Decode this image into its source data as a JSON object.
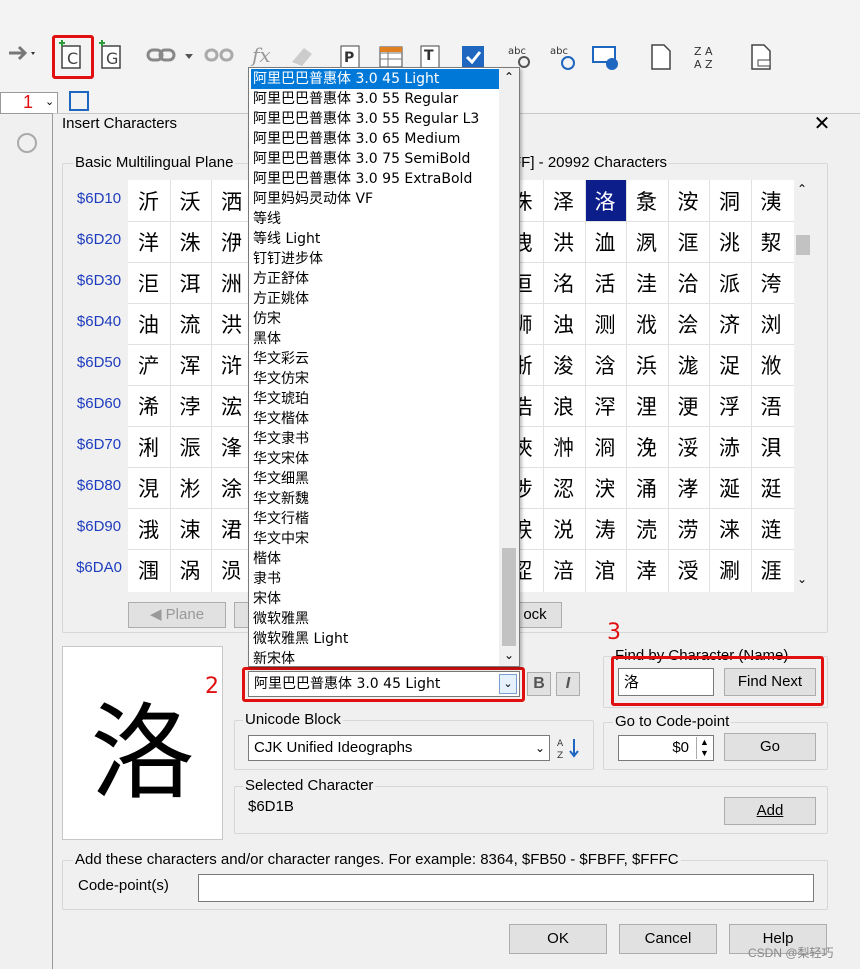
{
  "toolbar": {
    "row2_number_combo": "1",
    "callout_1": "1",
    "callout_2": "2",
    "callout_3": "3"
  },
  "dialog": {
    "title": "Insert Characters",
    "close_symbol": "✕",
    "plane_group_label": "Basic Multilingual Plane",
    "range_label_right": "FF] - 20992 Characters",
    "row_codes": [
      "$6D10",
      "$6D20",
      "$6D30",
      "$6D40",
      "$6D50",
      "$6D60",
      "$6D70",
      "$6D80",
      "$6D90",
      "$6DA0"
    ],
    "grid_left": [
      [
        "沂",
        "沃",
        "洒"
      ],
      [
        "洋",
        "洙",
        "洢"
      ],
      [
        "洰",
        "洱",
        "洲"
      ],
      [
        "油",
        "流",
        "洪"
      ],
      [
        "浐",
        "浑",
        "浒"
      ],
      [
        "浠",
        "浡",
        "浤"
      ],
      [
        "浰",
        "浱",
        "浲"
      ],
      [
        "涀",
        "涁",
        "涂"
      ],
      [
        "涐",
        "涑",
        "涒"
      ],
      [
        "涠",
        "涡",
        "涢"
      ]
    ],
    "grid_right": [
      [
        "洙",
        "泽",
        "洛",
        "洜",
        "洝",
        "洞",
        "洟"
      ],
      [
        "洩",
        "洪",
        "洫",
        "洬",
        "洭",
        "洮",
        "洯"
      ],
      [
        "洹",
        "洺",
        "活",
        "洼",
        "洽",
        "派",
        "洿"
      ],
      [
        "浉",
        "浊",
        "测",
        "浌",
        "浍",
        "济",
        "浏"
      ],
      [
        "浙",
        "浚",
        "浛",
        "浜",
        "浝",
        "浞",
        "浟"
      ],
      [
        "浩",
        "浪",
        "浫",
        "浬",
        "浭",
        "浮",
        "浯"
      ],
      [
        "浹",
        "浺",
        "浻",
        "浼",
        "浽",
        "浾",
        "浿"
      ],
      [
        "涉",
        "涊",
        "涋",
        "涌",
        "涍",
        "涎",
        "涏"
      ],
      [
        "涙",
        "涚",
        "涛",
        "涜",
        "涝",
        "涞",
        "涟"
      ],
      [
        "涩",
        "涪",
        "涫",
        "涬",
        "涭",
        "涮",
        "涯"
      ]
    ],
    "plane_button": "Plane",
    "block_button_fragment": "ock",
    "font_select_value": "阿里巴巴普惠体 3.0 45 Light",
    "bold_label": "B",
    "italic_label": "I",
    "unicode_block_label": "Unicode Block",
    "unicode_block_value": "CJK Unified Ideographs",
    "find_group_label": "Find by Character (Name)",
    "find_input_value": "洛",
    "find_next_button": "Find Next",
    "goto_group_label": "Go to Code-point",
    "goto_value": "$0",
    "go_button": "Go",
    "selected_label": "Selected Character",
    "selected_code": "$6D1B",
    "add_button": "Add",
    "add_ranges_label": "Add these characters and/or character ranges. For example: 8364, $FB50 - $FBFF, $FFFC",
    "codepoints_label": "Code-point(s)",
    "codepoints_value": "",
    "ok_button": "OK",
    "cancel_button": "Cancel",
    "help_button": "Help",
    "preview_char": "洛"
  },
  "font_list": [
    "阿里巴巴普惠体 3.0 45 Light",
    "阿里巴巴普惠体 3.0 55 Regular",
    "阿里巴巴普惠体 3.0 55 Regular L3",
    "阿里巴巴普惠体 3.0 65 Medium",
    "阿里巴巴普惠体 3.0 75 SemiBold",
    "阿里巴巴普惠体 3.0 95 ExtraBold",
    "阿里妈妈灵动体 VF",
    "等线",
    "等线 Light",
    "钉钉进步体",
    "方正舒体",
    "方正姚体",
    "仿宋",
    "黑体",
    "华文彩云",
    "华文仿宋",
    "华文琥珀",
    "华文楷体",
    "华文隶书",
    "华文宋体",
    "华文细黑",
    "华文新魏",
    "华文行楷",
    "华文中宋",
    "楷体",
    "隶书",
    "宋体",
    "微软雅黑",
    "微软雅黑 Light",
    "新宋体"
  ],
  "watermark": "CSDN @梨轻巧",
  "colors": {
    "selection": "#0b1e8a",
    "list_highlight": "#0078d7",
    "callout": "#e01010",
    "row_code": "#1e3cbe"
  }
}
